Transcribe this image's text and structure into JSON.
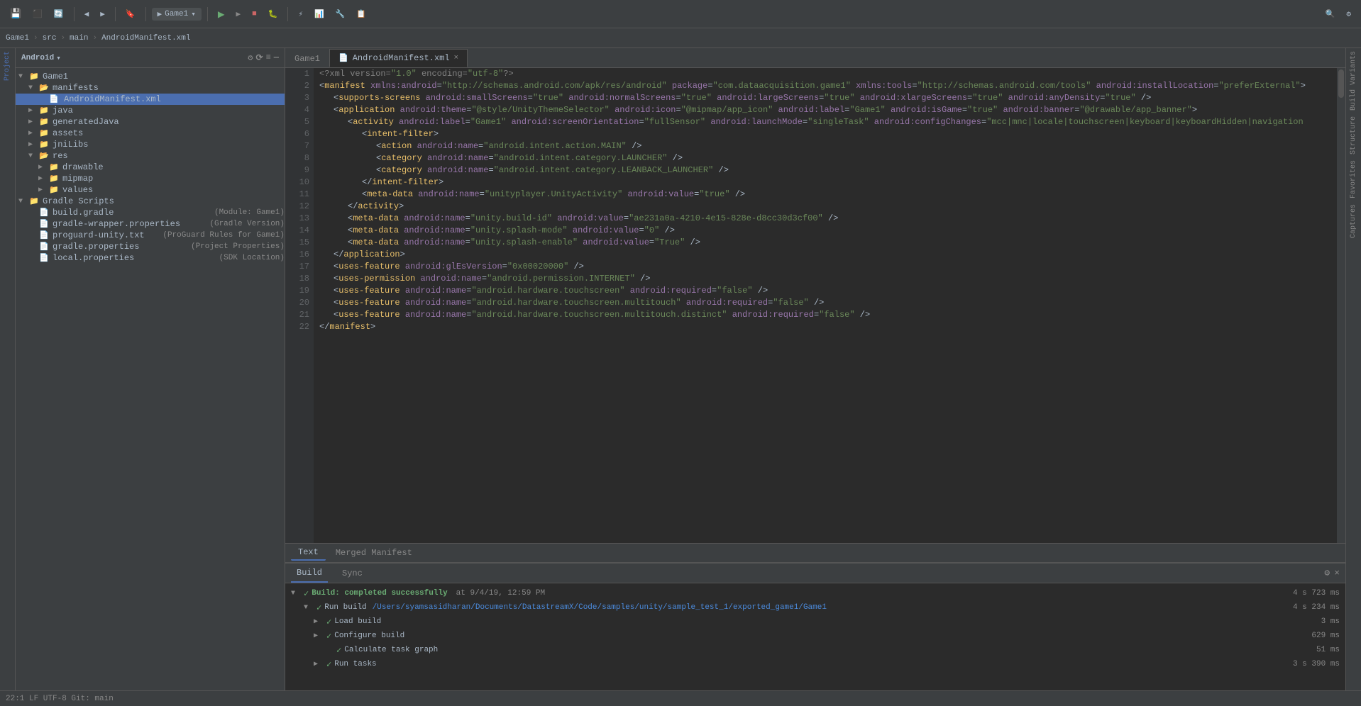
{
  "toolbar": {
    "project_name": "Game1",
    "run_config": "Game1",
    "breadcrumb": [
      "Game1",
      "src",
      "main",
      "AndroidManifest.xml"
    ]
  },
  "tabs": {
    "active": "AndroidManifest.xml",
    "items": [
      {
        "label": "Game1",
        "icon": "▶"
      },
      {
        "label": "AndroidManifest.xml",
        "active": true
      }
    ]
  },
  "bottom_tabs": {
    "items": [
      "Text",
      "Merged Manifest"
    ],
    "active": "Text"
  },
  "build_panel": {
    "tabs": [
      "Build",
      "Sync"
    ],
    "active": "Build",
    "result": "Build: completed successfully",
    "timestamp": "at 9/4/19, 12:59 PM",
    "run_build_label": "Run build",
    "run_build_path": "/Users/syamsasidharan/Documents/DatastreamX/Code/samples/unity/sample_test_1/exported_game1/Game1",
    "run_build_time": "4 s 234 ms",
    "load_build_label": "Load build",
    "load_build_time": "3 ms",
    "configure_build_label": "Configure build",
    "configure_build_time": "629 ms",
    "calculate_task_label": "Calculate task graph",
    "calculate_task_time": "51 ms",
    "run_tasks_label": "Run tasks",
    "run_tasks_time": "3 s 390 ms",
    "overall_time": "4 s 723 ms"
  },
  "file_tree": {
    "items": [
      {
        "label": "Game1",
        "type": "project",
        "indent": 0,
        "expanded": true,
        "arrow": "▼"
      },
      {
        "label": "manifests",
        "type": "folder",
        "indent": 1,
        "expanded": true,
        "arrow": "▼"
      },
      {
        "label": "AndroidManifest.xml",
        "type": "xml",
        "indent": 2,
        "expanded": false,
        "arrow": "",
        "selected": true
      },
      {
        "label": "java",
        "type": "folder",
        "indent": 1,
        "expanded": false,
        "arrow": "▶"
      },
      {
        "label": "generatedJava",
        "type": "folder",
        "indent": 1,
        "expanded": false,
        "arrow": "▶"
      },
      {
        "label": "assets",
        "type": "folder",
        "indent": 1,
        "expanded": false,
        "arrow": "▶"
      },
      {
        "label": "jniLibs",
        "type": "folder",
        "indent": 1,
        "expanded": false,
        "arrow": "▶"
      },
      {
        "label": "res",
        "type": "folder",
        "indent": 1,
        "expanded": true,
        "arrow": "▼"
      },
      {
        "label": "drawable",
        "type": "folder",
        "indent": 2,
        "expanded": false,
        "arrow": "▶"
      },
      {
        "label": "mipmap",
        "type": "folder",
        "indent": 2,
        "expanded": false,
        "arrow": "▶"
      },
      {
        "label": "values",
        "type": "folder",
        "indent": 2,
        "expanded": false,
        "arrow": "▶"
      },
      {
        "label": "Gradle Scripts",
        "type": "gradle-scripts",
        "indent": 0,
        "expanded": true,
        "arrow": "▼"
      },
      {
        "label": "build.gradle",
        "sublabel": "(Module: Game1)",
        "type": "gradle",
        "indent": 1,
        "expanded": false,
        "arrow": ""
      },
      {
        "label": "gradle-wrapper.properties",
        "sublabel": "(Gradle Version)",
        "type": "props",
        "indent": 1,
        "expanded": false,
        "arrow": ""
      },
      {
        "label": "proguard-unity.txt",
        "sublabel": "(ProGuard Rules for Game1)",
        "type": "txt",
        "indent": 1,
        "expanded": false,
        "arrow": ""
      },
      {
        "label": "gradle.properties",
        "sublabel": "(Project Properties)",
        "type": "props",
        "indent": 1,
        "expanded": false,
        "arrow": ""
      },
      {
        "label": "local.properties",
        "sublabel": "(SDK Location)",
        "type": "props",
        "indent": 1,
        "expanded": false,
        "arrow": ""
      }
    ]
  },
  "code": {
    "lines": [
      {
        "num": 1,
        "content": "<?xml version=\"1.0\" encoding=\"utf-8\"?>"
      },
      {
        "num": 2,
        "content": "<manifest xmlns:android=\"http://schemas.android.com/apk/res/android\" package=\"com.dataacquisition.game1\" xmlns:tools=\"http://schemas.android.com/tools\" android:installLocation=\"preferExternal\">"
      },
      {
        "num": 3,
        "content": "    <supports-screens android:smallScreens=\"true\" android:normalScreens=\"true\" android:largeScreens=\"true\" android:xlargeScreens=\"true\" android:anyDensity=\"true\" />"
      },
      {
        "num": 4,
        "content": "    <application android:theme=\"@style/UnityThemeSelector\" android:icon=\"@mipmap/app_icon\" android:label=\"Game1\" android:isGame=\"true\" android:banner=\"@drawable/app_banner\">"
      },
      {
        "num": 5,
        "content": "        <activity android:label=\"Game1\" android:screenOrientation=\"fullSensor\" android:launchMode=\"singleTask\" android:configChanges=\"mcc|mnc|locale|touchscreen|keyboard|keyboardHidden|navigation"
      },
      {
        "num": 6,
        "content": "            <intent-filter>"
      },
      {
        "num": 7,
        "content": "                <action android:name=\"android.intent.action.MAIN\" />"
      },
      {
        "num": 8,
        "content": "                <category android:name=\"android.intent.category.LAUNCHER\" />"
      },
      {
        "num": 9,
        "content": "                <category android:name=\"android.intent.category.LEANBACK_LAUNCHER\" />"
      },
      {
        "num": 10,
        "content": "            </intent-filter>"
      },
      {
        "num": 11,
        "content": "            <meta-data android:name=\"unityplayer.UnityActivity\" android:value=\"true\" />"
      },
      {
        "num": 12,
        "content": "        </activity>"
      },
      {
        "num": 13,
        "content": "        <meta-data android:name=\"unity.build-id\" android:value=\"ae231a0a-4210-4e15-828e-d8cc30d3cf00\" />"
      },
      {
        "num": 14,
        "content": "        <meta-data android:name=\"unity.splash-mode\" android:value=\"0\" />"
      },
      {
        "num": 15,
        "content": "        <meta-data android:name=\"unity.splash-enable\" android:value=\"True\" />"
      },
      {
        "num": 16,
        "content": "    </application>"
      },
      {
        "num": 17,
        "content": "    <uses-feature android:glEsVersion=\"0x00020000\" />"
      },
      {
        "num": 18,
        "content": "    <uses-permission android:name=\"android.permission.INTERNET\" />"
      },
      {
        "num": 19,
        "content": "    <uses-feature android:name=\"android.hardware.touchscreen\" android:required=\"false\" />"
      },
      {
        "num": 20,
        "content": "    <uses-feature android:name=\"android.hardware.touchscreen.multitouch\" android:required=\"false\" />"
      },
      {
        "num": 21,
        "content": "    <uses-feature android:name=\"android.hardware.touchscreen.multitouch.distinct\" android:required=\"false\" />"
      },
      {
        "num": 22,
        "content": "</manifest>"
      }
    ]
  },
  "panel_selector": "Android",
  "project_label": "Project"
}
